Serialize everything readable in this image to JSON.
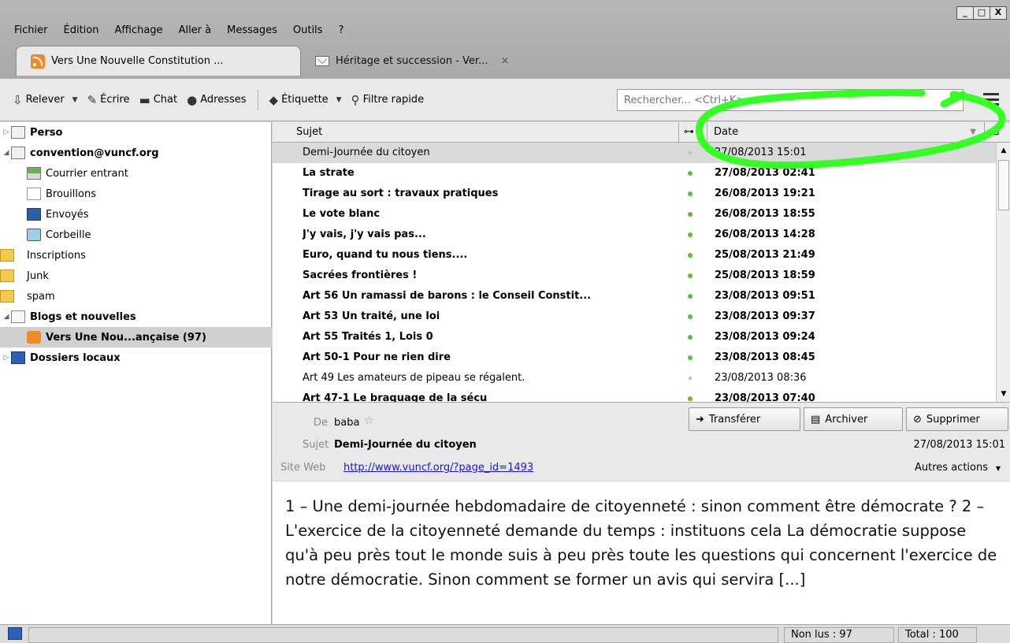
{
  "menubar": {
    "items": [
      {
        "label": "Fichier"
      },
      {
        "label": "Édition"
      },
      {
        "label": "Affichage"
      },
      {
        "label": "Aller à"
      },
      {
        "label": "Messages"
      },
      {
        "label": "Outils"
      },
      {
        "label": "?"
      }
    ]
  },
  "window_controls": {
    "minimize": "_",
    "maximize": "□",
    "close": "X"
  },
  "tabs": [
    {
      "label": "Vers Une Nouvelle Constitution ...",
      "icon": "rss-icon",
      "active": true
    },
    {
      "label": "Héritage et succession - Ver...",
      "icon": "mail-icon",
      "active": false,
      "close": "×"
    }
  ],
  "toolbar": {
    "relever": "Relever",
    "ecrire": "Écrire",
    "chat": "Chat",
    "adresses": "Adresses",
    "etiquette": "Étiquette",
    "filtre_rapide": "Filtre rapide",
    "search_placeholder": "Rechercher... <Ctrl+K>"
  },
  "folders": [
    {
      "label": "Perso",
      "bold": true,
      "level": 0,
      "twisty": "▷",
      "icon": "account"
    },
    {
      "label": "convention@vuncf.org",
      "bold": true,
      "level": 0,
      "twisty": "◢",
      "icon": "account"
    },
    {
      "label": "Courrier entrant",
      "bold": false,
      "level": 1,
      "icon": "inbox"
    },
    {
      "label": "Brouillons",
      "bold": false,
      "level": 1,
      "icon": "drafts"
    },
    {
      "label": "Envoyés",
      "bold": false,
      "level": 1,
      "icon": "sent"
    },
    {
      "label": "Corbeille",
      "bold": false,
      "level": 1,
      "icon": "trash"
    },
    {
      "label": "Inscriptions",
      "bold": false,
      "level": 1,
      "icon": "folder"
    },
    {
      "label": "Junk",
      "bold": false,
      "level": 1,
      "icon": "folder"
    },
    {
      "label": "spam",
      "bold": false,
      "level": 1,
      "icon": "folder"
    },
    {
      "label": "Blogs et nouvelles",
      "bold": true,
      "level": 0,
      "twisty": "◢",
      "icon": "blogs"
    },
    {
      "label": "Vers Une Nou...ançaise (97)",
      "bold": true,
      "level": 1,
      "icon": "rss",
      "selected": true
    },
    {
      "label": "Dossiers locaux",
      "bold": true,
      "level": 0,
      "twisty": "▷",
      "icon": "local"
    }
  ],
  "thread": {
    "columns": {
      "subject": "Sujet",
      "date": "Date"
    },
    "rows": [
      {
        "subject": "Demi-Journée du citoyen",
        "date": "27/08/2013 15:01",
        "unread": false,
        "selected": true
      },
      {
        "subject": "La strate",
        "date": "27/08/2013 02:41",
        "unread": true
      },
      {
        "subject": "Tirage au sort : travaux pratiques",
        "date": "26/08/2013 19:21",
        "unread": true
      },
      {
        "subject": "Le vote blanc",
        "date": "26/08/2013 18:55",
        "unread": true
      },
      {
        "subject": "J'y vais, j'y vais pas...",
        "date": "26/08/2013 14:28",
        "unread": true
      },
      {
        "subject": "Euro, quand tu nous tiens....",
        "date": "25/08/2013 21:49",
        "unread": true
      },
      {
        "subject": "Sacrées frontières !",
        "date": "25/08/2013 18:59",
        "unread": true
      },
      {
        "subject": "Art 56 Un ramassi de barons : le Conseil Constit...",
        "date": "23/08/2013 09:51",
        "unread": true
      },
      {
        "subject": "Art 53 Un traité, une loi",
        "date": "23/08/2013 09:37",
        "unread": true
      },
      {
        "subject": "Art 55 Traités 1, Lois 0",
        "date": "23/08/2013 09:24",
        "unread": true
      },
      {
        "subject": "Art 50-1 Pour ne rien dire",
        "date": "23/08/2013 08:45",
        "unread": true
      },
      {
        "subject": "Art 49 Les amateurs de pipeau se régalent.",
        "date": "23/08/2013 08:36",
        "unread": false
      },
      {
        "subject": "Art 47-1 Le braquage de la sécu",
        "date": "23/08/2013 07:40",
        "unread": true
      }
    ]
  },
  "message": {
    "from_label": "De",
    "from": "baba",
    "subject_label": "Sujet",
    "subject": "Demi-Journée du citoyen",
    "date": "27/08/2013 15:01",
    "website_label": "Site Web",
    "website": "http://www.vuncf.org/?page_id=1493",
    "actions": {
      "forward": "Transférer",
      "archive": "Archiver",
      "delete": "Supprimer",
      "more": "Autres actions"
    },
    "body": "1 – Une demi-journée hebdomadaire de citoyenneté : sinon comment être démocrate ? 2 – L'exercice de la citoyenneté demande du temps : instituons cela La démocratie suppose qu'à peu près tout le monde suis à peu près toute les questions qui concernent l'exercice de notre démocratie. Sinon comment se former un avis qui servira [...]"
  },
  "status": {
    "unread": "Non lus : 97",
    "total": "Total : 100"
  },
  "colors": {
    "annotation": "#33ff22",
    "unread_dot": "#5fbf2e",
    "link": "#1a1ab8",
    "rss": "#f08a24"
  }
}
